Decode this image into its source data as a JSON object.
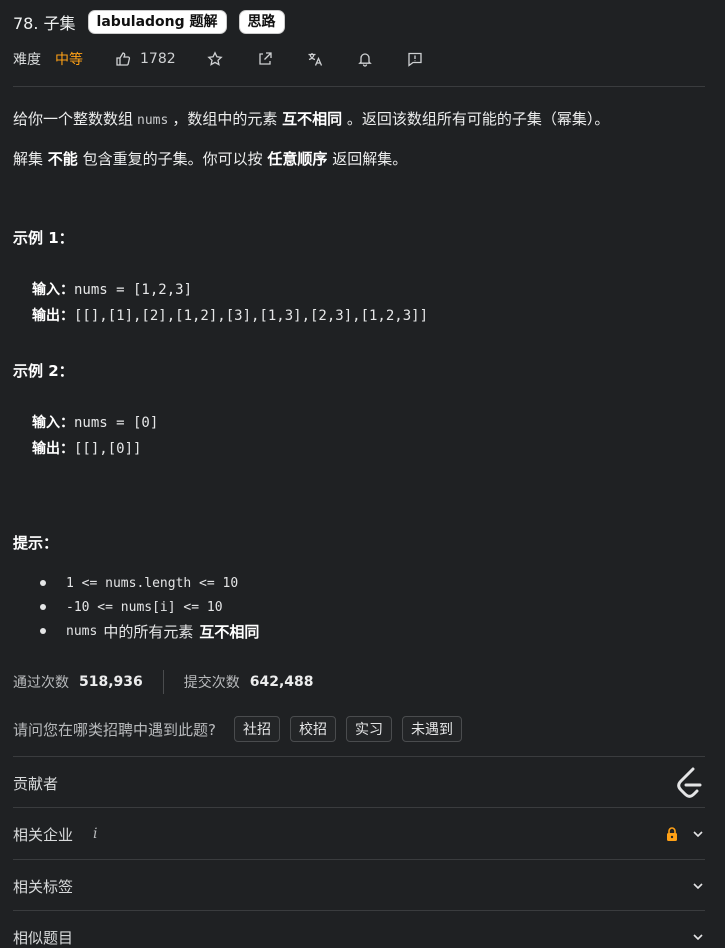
{
  "problem": {
    "title": "78. 子集",
    "tags": [
      "labuladong 题解",
      "思路"
    ]
  },
  "meta": {
    "difficulty_label": "难度",
    "difficulty": "中等",
    "likes": "1782",
    "icons": [
      "thumb-up-icon",
      "star-icon",
      "share-icon",
      "translate-icon",
      "bell-icon",
      "feedback-icon"
    ]
  },
  "description": {
    "p1_before": "给你一个整数数组",
    "p1_code": "nums",
    "p1_middle": "，数组中的元素",
    "p1_bold": "互不相同",
    "p1_after": "。返回该数组所有可能的子集（幂集）。",
    "p2_before": "解集",
    "p2_bold1": "不能",
    "p2_middle": "包含重复的子集。你可以按",
    "p2_bold2": "任意顺序",
    "p2_after": "返回解集。"
  },
  "examples": [
    {
      "heading": "示例 1：",
      "input_label": "输入：",
      "input": "nums = [1,2,3]",
      "output_label": "输出：",
      "output": "[[],[1],[2],[1,2],[3],[1,3],[2,3],[1,2,3]]"
    },
    {
      "heading": "示例 2：",
      "input_label": "输入：",
      "input": "nums = [0]",
      "output_label": "输出：",
      "output": "[[],[0]]"
    }
  ],
  "hints": {
    "heading": "提示：",
    "items": [
      "1 <= nums.length <= 10",
      "-10 <= nums[i] <= 10"
    ],
    "item3_code": "nums",
    "item3_text": "中的所有元素",
    "item3_bold": "互不相同"
  },
  "stats": {
    "accepted_label": "通过次数",
    "accepted": "518,936",
    "submitted_label": "提交次数",
    "submitted": "642,488"
  },
  "recruit": {
    "question": "请问您在哪类招聘中遇到此题?",
    "options": [
      "社招",
      "校招",
      "实习",
      "未遇到"
    ]
  },
  "sections": {
    "contributors": "贡献者",
    "companies": "相关企业",
    "companies_info": "i",
    "tags": "相关标签",
    "similar": "相似题目"
  },
  "colors": {
    "background": "#1f2123",
    "difficulty_medium": "#ffa116",
    "lock": "#ffa116"
  }
}
